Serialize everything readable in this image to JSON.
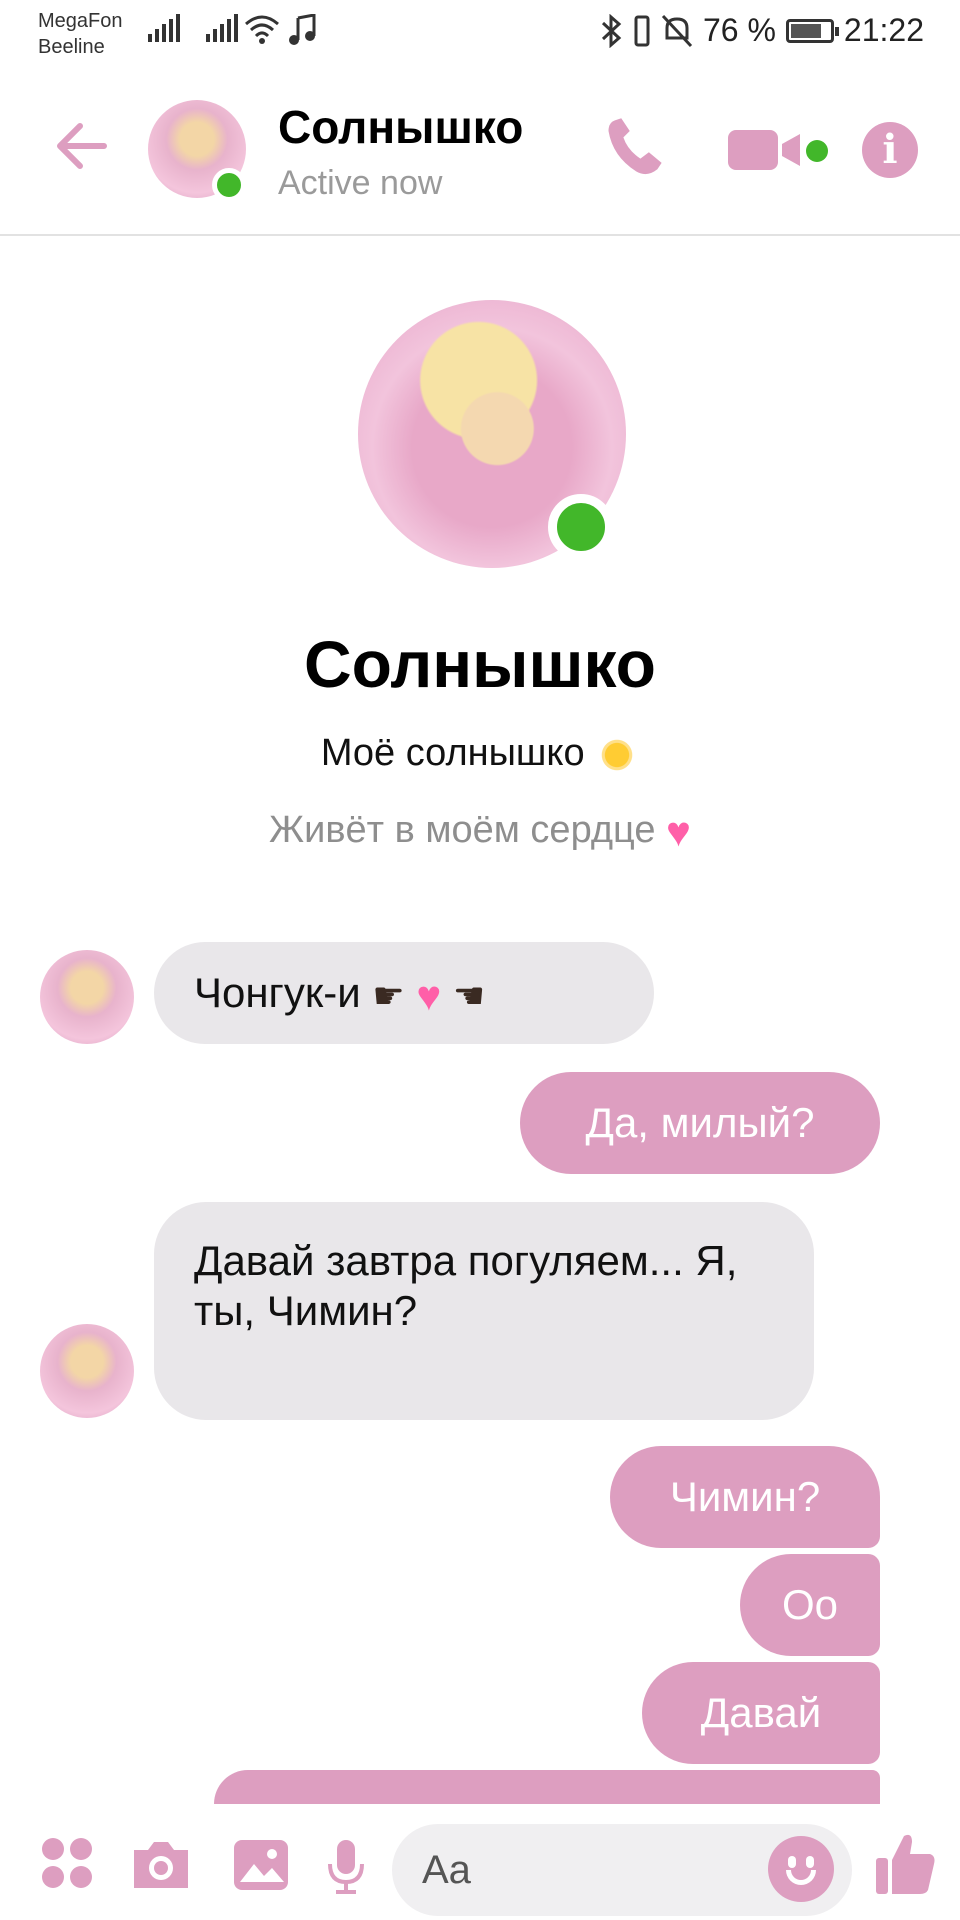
{
  "status_bar": {
    "carrier1": "MegaFon",
    "carrier2": "Beeline",
    "battery": "76 %",
    "battery_level": 0.76,
    "time": "21:22"
  },
  "header": {
    "name": "Солнышко",
    "status": "Active now"
  },
  "profile": {
    "name": "Солнышко",
    "line1": "Моё солнышко",
    "line2": "Живёт в моём сердце"
  },
  "messages": [
    {
      "direction": "incoming",
      "text": "Чонгук-и"
    },
    {
      "direction": "outgoing",
      "text": "Да, милый?"
    },
    {
      "direction": "incoming",
      "text": "Давай завтра погуляем... Я, ты, Чимин?"
    },
    {
      "direction": "outgoing",
      "text": "Чимин?"
    },
    {
      "direction": "outgoing",
      "text": "Оо"
    },
    {
      "direction": "outgoing",
      "text": "Давай"
    }
  ],
  "composer": {
    "placeholder": "Aa"
  },
  "colors": {
    "accent": "#dd9ec0",
    "online": "#42b72a",
    "incoming_bubble": "#e9e7ea"
  },
  "icons": [
    "back-arrow-icon",
    "phone-icon",
    "video-icon",
    "info-icon",
    "apps-icon",
    "camera-icon",
    "image-icon",
    "mic-icon",
    "emoji-icon",
    "like-icon"
  ]
}
